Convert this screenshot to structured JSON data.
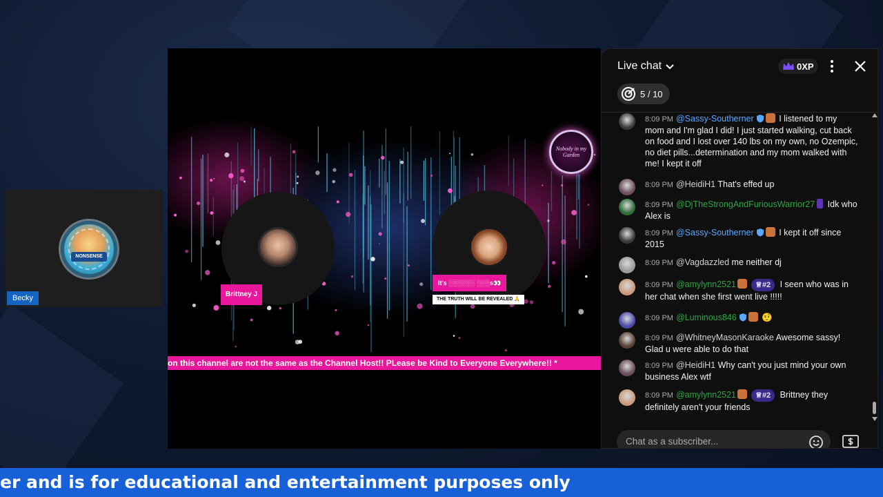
{
  "guest": {
    "name": "Becky",
    "avatar_text": "NONSENSE"
  },
  "stage": {
    "host_left_name": "Brittney J",
    "host_right_tag": "It's ░░░░░░ ░░░s👀",
    "host_right_subtag": "THE TRUTH WILL BE REVEALED 🙏",
    "logo_text": "Nobody in my Garden",
    "ticker": "on this channel are not the same as the Channel Host!! PLease be Kind to Everyone Everywhere!! *"
  },
  "chat": {
    "title": "Live chat",
    "xp_label": "0XP",
    "goal_label": "5 / 10",
    "input_placeholder": "Chat as a subscriber...",
    "accent": "#5e35b1",
    "messages": [
      {
        "time": "8:09 PM",
        "user": "@Sassy-Southerner",
        "color": "blue",
        "verified": true,
        "member": true,
        "rank": "",
        "text": "I listened to my mom and I'm glad I did! I just started walking, cut back on food and I lost over 140 lbs on my own, no Ozempic, no diet pills...determination and my mom walked with me! I kept it off"
      },
      {
        "time": "8:09 PM",
        "user": "@HeidiH1",
        "color": "grey",
        "verified": false,
        "member": false,
        "rank": "",
        "text": "That's effed up"
      },
      {
        "time": "8:09 PM",
        "user": "@DjTheStrongAndFuriousWarrior27",
        "color": "green",
        "verified": false,
        "member": false,
        "rank": "",
        "text": "Idk who Alex is"
      },
      {
        "time": "8:09 PM",
        "user": "@Sassy-Southerner",
        "color": "blue",
        "verified": true,
        "member": true,
        "rank": "",
        "text": "I kept it off since 2015"
      },
      {
        "time": "8:09 PM",
        "user": "@Vagdazzled",
        "color": "grey",
        "verified": false,
        "member": false,
        "rank": "",
        "text": "me neither dj"
      },
      {
        "time": "8:09 PM",
        "user": "@amylynn2521",
        "color": "green",
        "verified": false,
        "member": true,
        "rank": "#2",
        "text": "I seen who was in her chat when she first went live !!!!!"
      },
      {
        "time": "8:09 PM",
        "user": "@Luminous846",
        "color": "green",
        "verified": true,
        "member": true,
        "rank": "",
        "text": "🤨"
      },
      {
        "time": "8:09 PM",
        "user": "@WhitneyMasonKaraoke",
        "color": "grey",
        "verified": false,
        "member": false,
        "rank": "",
        "text": "Awesome sassy! Glad u were able to do that"
      },
      {
        "time": "8:09 PM",
        "user": "@HeidiH1",
        "color": "grey",
        "verified": false,
        "member": false,
        "rank": "",
        "text": "Why can't you just mind your own business Alex wtf"
      },
      {
        "time": "8:09 PM",
        "user": "@amylynn2521",
        "color": "green",
        "verified": false,
        "member": true,
        "rank": "#2",
        "text": "Brittney they definitely aren't your friends"
      }
    ]
  },
  "banner": {
    "text": "er and is for educational and entertainment purposes only"
  },
  "colors": {
    "brand_pink": "#e8179b",
    "banner_blue": "#1760d8",
    "chat_bg": "#0f0f0f"
  }
}
